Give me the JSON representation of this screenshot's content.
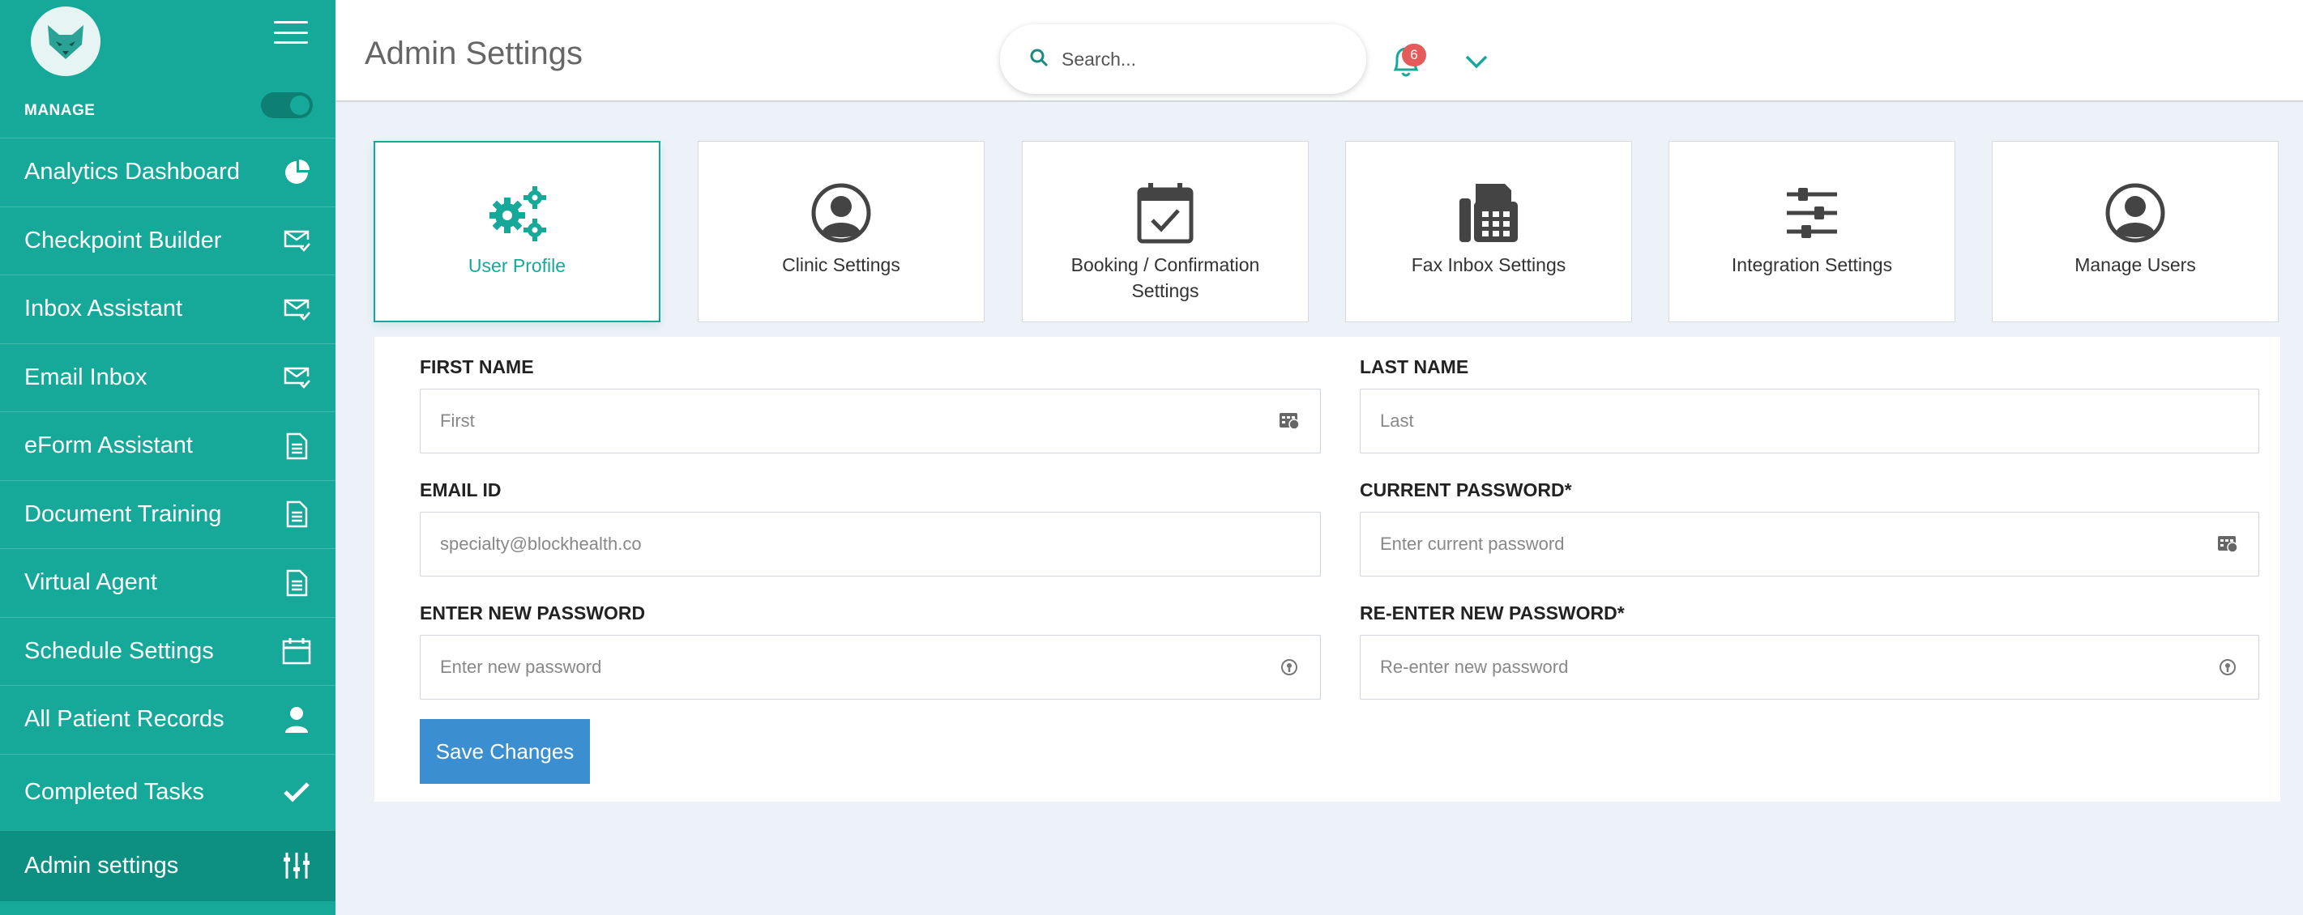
{
  "sidebar": {
    "section_label": "MANAGE",
    "items": [
      {
        "label": "Analytics Dashboard",
        "icon": "pie-chart-icon"
      },
      {
        "label": "Checkpoint Builder",
        "icon": "mail-check-icon"
      },
      {
        "label": "Inbox Assistant",
        "icon": "mail-check-icon"
      },
      {
        "label": "Email Inbox",
        "icon": "mail-check-icon"
      },
      {
        "label": "eForm Assistant",
        "icon": "document-icon"
      },
      {
        "label": "Document Training",
        "icon": "document-icon"
      },
      {
        "label": "Virtual Agent",
        "icon": "document-icon"
      },
      {
        "label": "Schedule Settings",
        "icon": "calendar-icon"
      },
      {
        "label": "All Patient Records",
        "icon": "user-icon"
      },
      {
        "label": "Completed Tasks",
        "icon": "checkmark-icon"
      },
      {
        "label": "Admin settings",
        "icon": "sliders-icon"
      }
    ]
  },
  "header": {
    "title": "Admin Settings",
    "search_placeholder": "Search...",
    "notification_count": "6"
  },
  "cards": [
    {
      "label": "User Profile",
      "icon": "gears-icon",
      "active": true
    },
    {
      "label": "Clinic Settings",
      "icon": "user-circle-icon"
    },
    {
      "label": "Booking / Confirmation Settings",
      "icon": "calendar-check-icon"
    },
    {
      "label": "Fax Inbox Settings",
      "icon": "fax-icon"
    },
    {
      "label": "Integration Settings",
      "icon": "sliders-icon"
    },
    {
      "label": "Manage Users",
      "icon": "user-circle-icon"
    }
  ],
  "form": {
    "first_name": {
      "label": "FIRST NAME",
      "placeholder": "First"
    },
    "last_name": {
      "label": "LAST NAME",
      "placeholder": "Last"
    },
    "email": {
      "label": "EMAIL ID",
      "placeholder": "specialty@blockhealth.co"
    },
    "current_password": {
      "label": "CURRENT PASSWORD*",
      "placeholder": "Enter current password"
    },
    "new_password": {
      "label": "ENTER NEW PASSWORD",
      "placeholder": "Enter new password"
    },
    "reenter_password": {
      "label": "RE-ENTER NEW PASSWORD*",
      "placeholder": "Re-enter new password"
    },
    "save_label": "Save Changes"
  },
  "colors": {
    "brand": "#16a99a",
    "brand_dark": "#0d8f81",
    "button": "#3b8fd0",
    "badge": "#e55b5b"
  }
}
